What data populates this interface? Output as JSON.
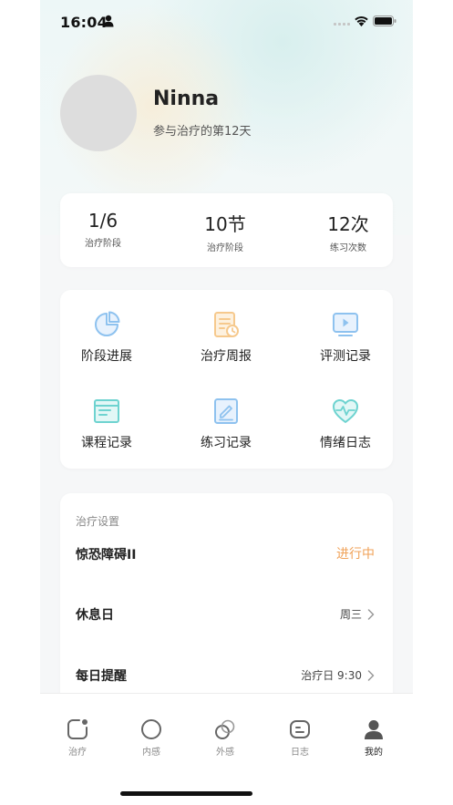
{
  "status_bar": {
    "time": "16:04"
  },
  "profile": {
    "name": "Ninna",
    "subtitle": "参与治疗的第12天"
  },
  "stats": [
    {
      "value": "1/6",
      "label": "治疗阶段"
    },
    {
      "value": "10节",
      "label": "治疗阶段"
    },
    {
      "value": "12次",
      "label": "练习次数"
    }
  ],
  "menu": {
    "items": [
      {
        "label": "阶段进展",
        "icon": "pie-chart-icon"
      },
      {
        "label": "治疗周报",
        "icon": "report-icon"
      },
      {
        "label": "评测记录",
        "icon": "video-play-icon"
      },
      {
        "label": "课程记录",
        "icon": "notebook-icon"
      },
      {
        "label": "练习记录",
        "icon": "edit-note-icon"
      },
      {
        "label": "情绪日志",
        "icon": "heart-pulse-icon"
      }
    ]
  },
  "settings": {
    "title": "治疗设置",
    "rows": [
      {
        "name": "惊恐障碍II",
        "value": "进行中"
      },
      {
        "name": "休息日",
        "value": "周三"
      },
      {
        "name": "每日提醒",
        "value": "治疗日 9:30"
      }
    ]
  },
  "tabbar": {
    "tabs": [
      {
        "label": "治疗"
      },
      {
        "label": "内感"
      },
      {
        "label": "外感"
      },
      {
        "label": "日志"
      },
      {
        "label": "我的"
      }
    ],
    "active": "我的"
  },
  "colors": {
    "accent_status": "#f0a258",
    "icon_blue": "#8ec2ef",
    "icon_orange": "#f6c98d",
    "icon_teal": "#6ed3d0"
  }
}
